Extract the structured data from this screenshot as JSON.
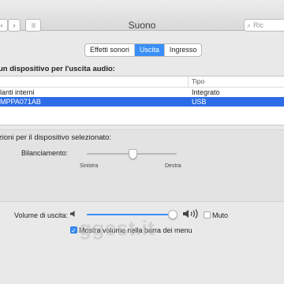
{
  "window": {
    "title": "Suono"
  },
  "toolbar": {
    "back_icon": "chevron-left-icon",
    "forward_icon": "chevron-right-icon",
    "grid_icon": "grid-icon",
    "search_placeholder": "Ric"
  },
  "tabs": [
    {
      "label": "Effetti sonori",
      "active": false
    },
    {
      "label": "Uscita",
      "active": true
    },
    {
      "label": "Ingresso",
      "active": false
    }
  ],
  "section_title": "un dispositivo per l'uscita audio:",
  "table": {
    "columns": [
      "",
      "Tipo"
    ],
    "rows": [
      {
        "name": "lanti interni",
        "type": "Integrato",
        "selected": false
      },
      {
        "name": "MPPA071AB",
        "type": "USB",
        "selected": true
      }
    ]
  },
  "settings_title": "zioni per il dispositivo selezionato:",
  "balance": {
    "label": "Bilanciamento:",
    "left_label": "Sinistra",
    "right_label": "Destra",
    "value": 0.5
  },
  "volume": {
    "label": "Volume di uscita:",
    "value": 0.97,
    "mute_label": "Muto",
    "muted": false,
    "show_in_menubar_label": "Mostra volume nella barra dei menu",
    "show_in_menubar": true
  },
  "watermark": "ggest.it",
  "colors": {
    "accent": "#3a8ef7",
    "selection": "#2c6ce6"
  }
}
